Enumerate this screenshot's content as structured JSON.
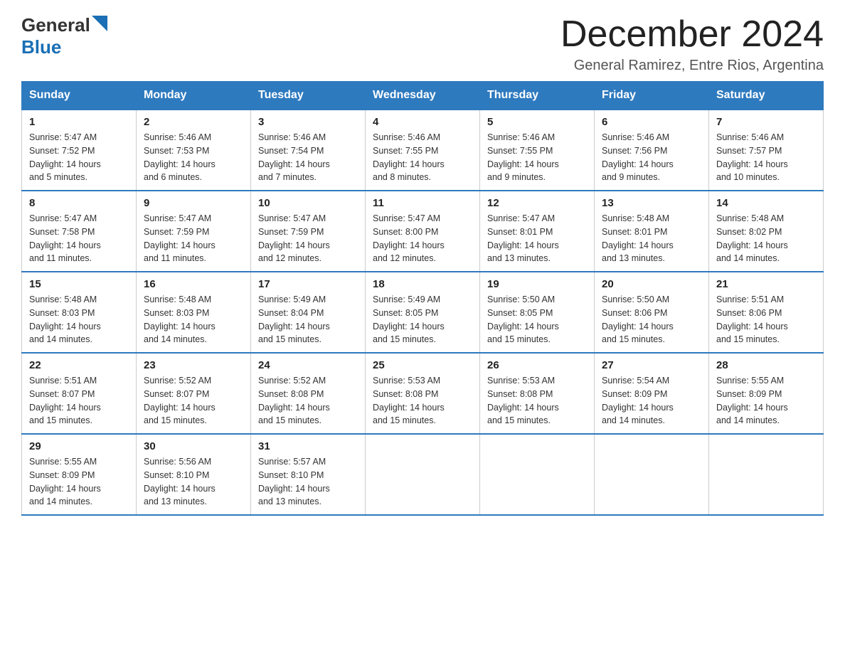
{
  "header": {
    "logo_general": "General",
    "logo_blue": "Blue",
    "month_year": "December 2024",
    "location": "General Ramirez, Entre Rios, Argentina"
  },
  "weekdays": [
    "Sunday",
    "Monday",
    "Tuesday",
    "Wednesday",
    "Thursday",
    "Friday",
    "Saturday"
  ],
  "weeks": [
    [
      {
        "day": "1",
        "sunrise": "5:47 AM",
        "sunset": "7:52 PM",
        "daylight": "14 hours and 5 minutes."
      },
      {
        "day": "2",
        "sunrise": "5:46 AM",
        "sunset": "7:53 PM",
        "daylight": "14 hours and 6 minutes."
      },
      {
        "day": "3",
        "sunrise": "5:46 AM",
        "sunset": "7:54 PM",
        "daylight": "14 hours and 7 minutes."
      },
      {
        "day": "4",
        "sunrise": "5:46 AM",
        "sunset": "7:55 PM",
        "daylight": "14 hours and 8 minutes."
      },
      {
        "day": "5",
        "sunrise": "5:46 AM",
        "sunset": "7:55 PM",
        "daylight": "14 hours and 9 minutes."
      },
      {
        "day": "6",
        "sunrise": "5:46 AM",
        "sunset": "7:56 PM",
        "daylight": "14 hours and 9 minutes."
      },
      {
        "day": "7",
        "sunrise": "5:46 AM",
        "sunset": "7:57 PM",
        "daylight": "14 hours and 10 minutes."
      }
    ],
    [
      {
        "day": "8",
        "sunrise": "5:47 AM",
        "sunset": "7:58 PM",
        "daylight": "14 hours and 11 minutes."
      },
      {
        "day": "9",
        "sunrise": "5:47 AM",
        "sunset": "7:59 PM",
        "daylight": "14 hours and 11 minutes."
      },
      {
        "day": "10",
        "sunrise": "5:47 AM",
        "sunset": "7:59 PM",
        "daylight": "14 hours and 12 minutes."
      },
      {
        "day": "11",
        "sunrise": "5:47 AM",
        "sunset": "8:00 PM",
        "daylight": "14 hours and 12 minutes."
      },
      {
        "day": "12",
        "sunrise": "5:47 AM",
        "sunset": "8:01 PM",
        "daylight": "14 hours and 13 minutes."
      },
      {
        "day": "13",
        "sunrise": "5:48 AM",
        "sunset": "8:01 PM",
        "daylight": "14 hours and 13 minutes."
      },
      {
        "day": "14",
        "sunrise": "5:48 AM",
        "sunset": "8:02 PM",
        "daylight": "14 hours and 14 minutes."
      }
    ],
    [
      {
        "day": "15",
        "sunrise": "5:48 AM",
        "sunset": "8:03 PM",
        "daylight": "14 hours and 14 minutes."
      },
      {
        "day": "16",
        "sunrise": "5:48 AM",
        "sunset": "8:03 PM",
        "daylight": "14 hours and 14 minutes."
      },
      {
        "day": "17",
        "sunrise": "5:49 AM",
        "sunset": "8:04 PM",
        "daylight": "14 hours and 15 minutes."
      },
      {
        "day": "18",
        "sunrise": "5:49 AM",
        "sunset": "8:05 PM",
        "daylight": "14 hours and 15 minutes."
      },
      {
        "day": "19",
        "sunrise": "5:50 AM",
        "sunset": "8:05 PM",
        "daylight": "14 hours and 15 minutes."
      },
      {
        "day": "20",
        "sunrise": "5:50 AM",
        "sunset": "8:06 PM",
        "daylight": "14 hours and 15 minutes."
      },
      {
        "day": "21",
        "sunrise": "5:51 AM",
        "sunset": "8:06 PM",
        "daylight": "14 hours and 15 minutes."
      }
    ],
    [
      {
        "day": "22",
        "sunrise": "5:51 AM",
        "sunset": "8:07 PM",
        "daylight": "14 hours and 15 minutes."
      },
      {
        "day": "23",
        "sunrise": "5:52 AM",
        "sunset": "8:07 PM",
        "daylight": "14 hours and 15 minutes."
      },
      {
        "day": "24",
        "sunrise": "5:52 AM",
        "sunset": "8:08 PM",
        "daylight": "14 hours and 15 minutes."
      },
      {
        "day": "25",
        "sunrise": "5:53 AM",
        "sunset": "8:08 PM",
        "daylight": "14 hours and 15 minutes."
      },
      {
        "day": "26",
        "sunrise": "5:53 AM",
        "sunset": "8:08 PM",
        "daylight": "14 hours and 15 minutes."
      },
      {
        "day": "27",
        "sunrise": "5:54 AM",
        "sunset": "8:09 PM",
        "daylight": "14 hours and 14 minutes."
      },
      {
        "day": "28",
        "sunrise": "5:55 AM",
        "sunset": "8:09 PM",
        "daylight": "14 hours and 14 minutes."
      }
    ],
    [
      {
        "day": "29",
        "sunrise": "5:55 AM",
        "sunset": "8:09 PM",
        "daylight": "14 hours and 14 minutes."
      },
      {
        "day": "30",
        "sunrise": "5:56 AM",
        "sunset": "8:10 PM",
        "daylight": "14 hours and 13 minutes."
      },
      {
        "day": "31",
        "sunrise": "5:57 AM",
        "sunset": "8:10 PM",
        "daylight": "14 hours and 13 minutes."
      },
      null,
      null,
      null,
      null
    ]
  ],
  "labels": {
    "sunrise": "Sunrise:",
    "sunset": "Sunset:",
    "daylight": "Daylight:"
  }
}
